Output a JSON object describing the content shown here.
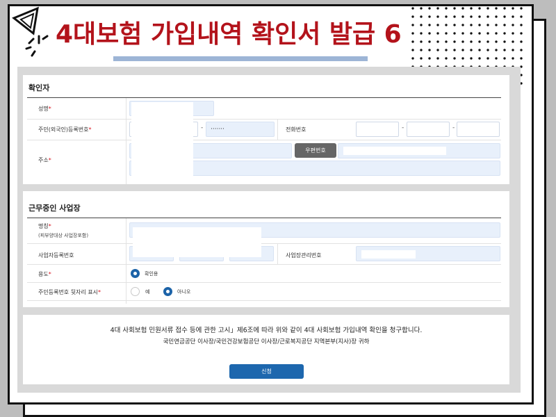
{
  "header": {
    "title": "4대보험 가입내역 확인서 발급 6"
  },
  "section_confirmer": {
    "title": "확인자",
    "name_label": "성명",
    "rrn_label": "주민(외국인)등록번호",
    "rrn_back_value": "·······",
    "phone_label": "전화번호",
    "address_label": "주소",
    "zip_button": "우편번호",
    "required_mark": "*"
  },
  "section_workplace": {
    "title": "근무중인 사업장",
    "name_label": "명칭",
    "name_sublabel": "(피부양대상 사업장포함)",
    "bizno_label": "사업자등록번호",
    "mgmtno_label": "사업장관리번호",
    "purpose_label": "용도",
    "purpose_option": "확인용",
    "rrn_display_label": "주민등록번호 뒷자리 표시",
    "option_yes": "예",
    "option_no": "아니오",
    "required_mark": "*"
  },
  "footer": {
    "notice_line1": "4대 사회보험 민원서류 접수 등에 관한 고시」제6조에 따라 위와 같이 4대 사회보험 가입내역 확인을 청구합니다.",
    "notice_line2": "국민연금공단 이사장/국민건강보험공단 이사장/근로복지공단 지역본부(지사)장 귀하",
    "submit_label": "신청"
  },
  "colors": {
    "title_red": "#b3131b",
    "required_red": "#d9141f",
    "primary_blue": "#1d67ae",
    "input_fill": "#e8f0fb"
  }
}
